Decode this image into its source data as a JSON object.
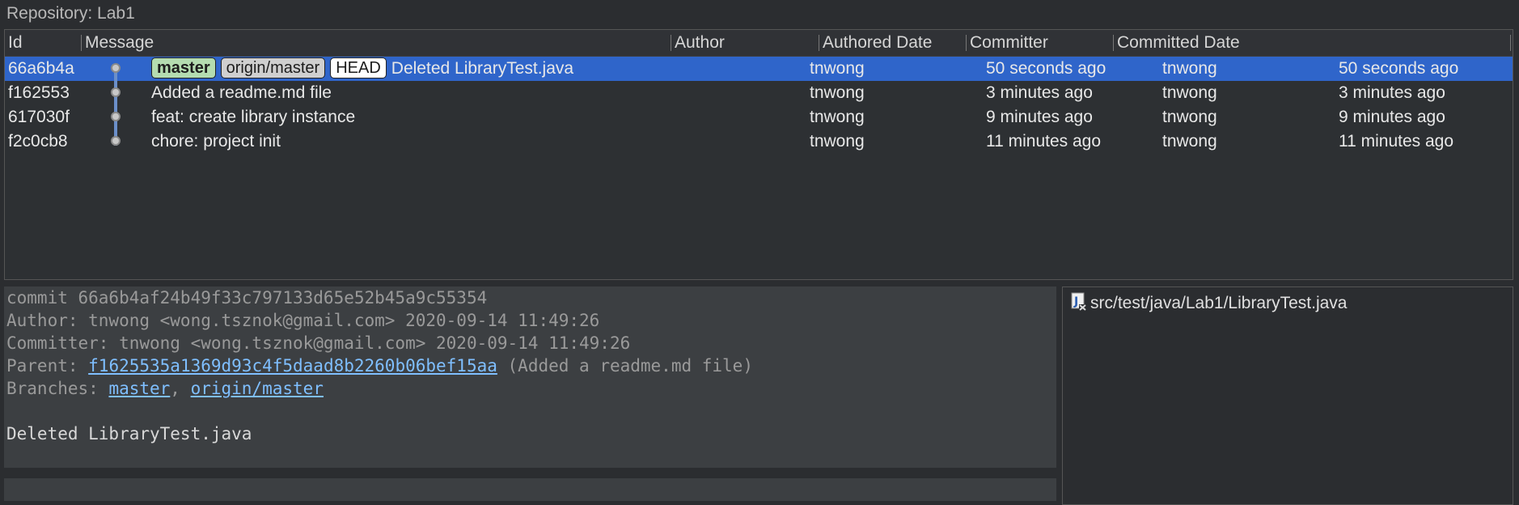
{
  "repository": {
    "label": "Repository: Lab1"
  },
  "columns": {
    "id": "Id",
    "message": "Message",
    "author": "Author",
    "authored_date": "Authored Date",
    "committer": "Committer",
    "committed_date": "Committed Date"
  },
  "commits": [
    {
      "id": "66a6b4a",
      "tags": {
        "master": "master",
        "origin": "origin/master",
        "head": "HEAD"
      },
      "message": "Deleted LibraryTest.java",
      "author": "tnwong",
      "authored_date": "50 seconds ago",
      "committer": "tnwong",
      "committed_date": "50 seconds ago"
    },
    {
      "id": "f162553",
      "message": "Added a readme.md file",
      "author": "tnwong",
      "authored_date": "3 minutes ago",
      "committer": "tnwong",
      "committed_date": "3 minutes ago"
    },
    {
      "id": "617030f",
      "message": "feat: create library instance",
      "author": "tnwong",
      "authored_date": "9 minutes ago",
      "committer": "tnwong",
      "committed_date": "9 minutes ago"
    },
    {
      "id": "f2c0cb8",
      "message": "chore: project init",
      "author": "tnwong",
      "authored_date": "11 minutes ago",
      "committer": "tnwong",
      "committed_date": "11 minutes ago"
    }
  ],
  "details": {
    "commit_line": "commit 66a6b4af24b49f33c797133d65e52b45a9c55354",
    "author_line": "Author: tnwong <wong.tsznok@gmail.com> 2020-09-14 11:49:26",
    "committer_line": "Committer: tnwong <wong.tsznok@gmail.com> 2020-09-14 11:49:26",
    "parent_label": "Parent: ",
    "parent_hash": "f1625535a1369d93c4f5daad8b2260b06bef15aa",
    "parent_desc": " (Added a readme.md file)",
    "branches_label": "Branches: ",
    "branch_master": "master",
    "branch_sep": ", ",
    "branch_origin": "origin/master",
    "message": "Deleted LibraryTest.java"
  },
  "files": [
    {
      "path": "src/test/java/Lab1/LibraryTest.java",
      "icon": "java-file-deleted-icon"
    }
  ],
  "colors": {
    "selection": "#2f65ca",
    "link": "#7fbfff",
    "tag_master": "#b4dcb0"
  }
}
